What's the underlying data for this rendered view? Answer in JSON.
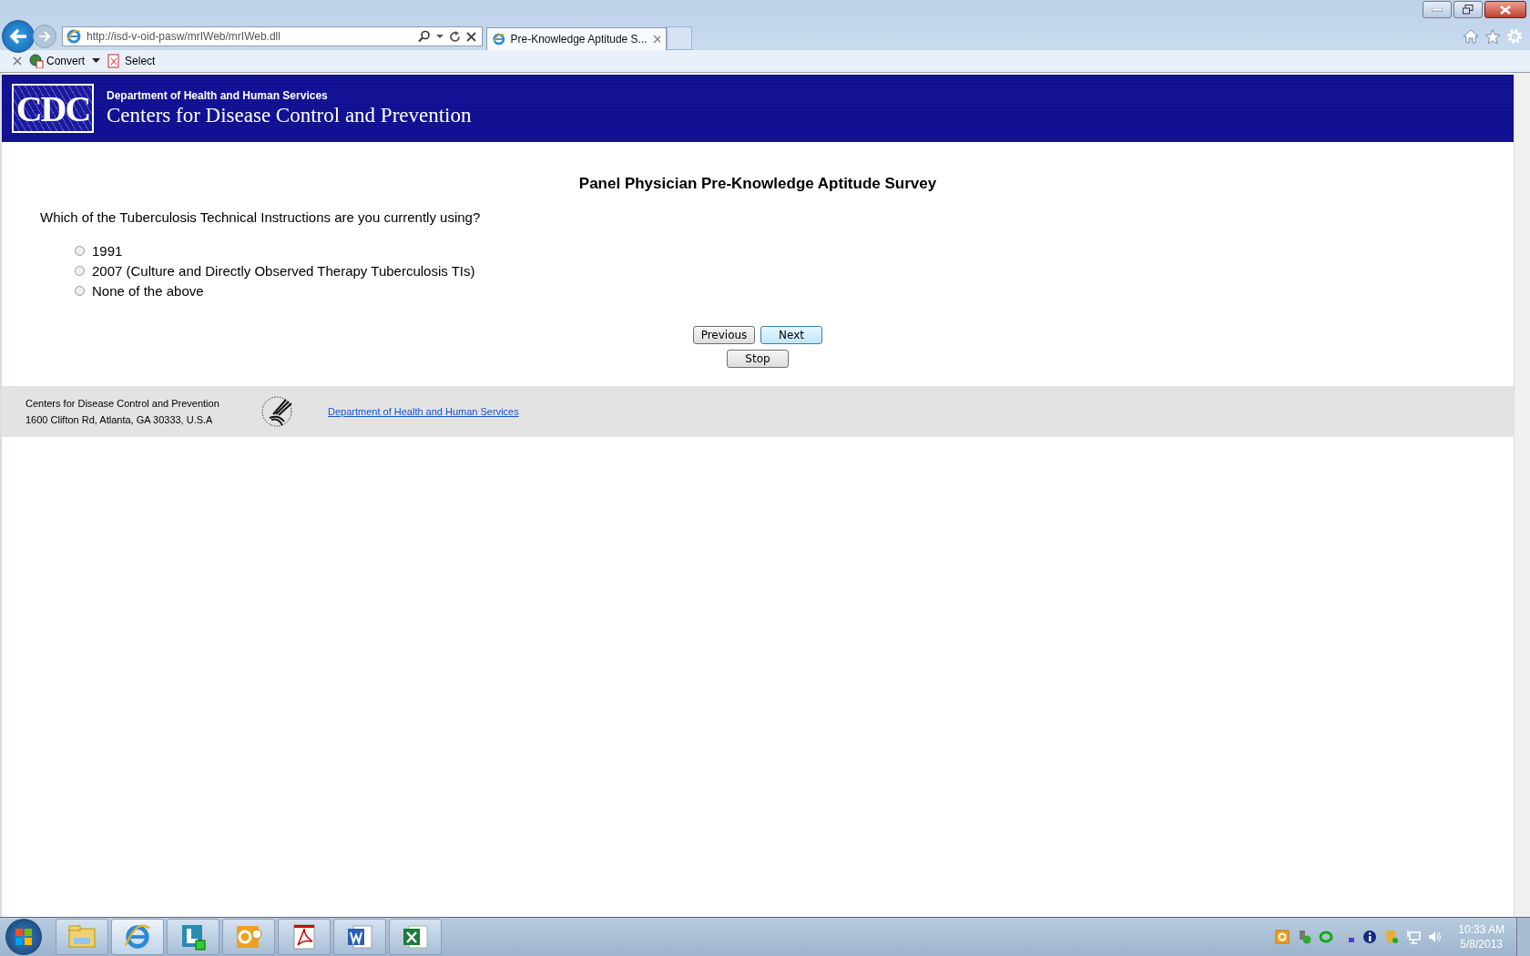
{
  "browser": {
    "url": "http://isd-v-oid-pasw/mrIWeb/mrIWeb.dll",
    "tab_title": "Pre-Knowledge Aptitude S...",
    "command_bar": [
      "Convert",
      "Select"
    ]
  },
  "header": {
    "logo": "CDC",
    "department": "Department of Health and Human Services",
    "title": "Centers for Disease Control and Prevention"
  },
  "survey": {
    "title": "Panel Physician Pre-Knowledge Aptitude Survey",
    "question": "Which of the Tuberculosis Technical Instructions are you currently using?",
    "options": [
      {
        "label": "1991",
        "selected": false
      },
      {
        "label": "2007 (Culture and Directly Observed Therapy Tuberculosis TIs)",
        "selected": false
      },
      {
        "label": "None of the above",
        "selected": false
      }
    ],
    "buttons": [
      {
        "label": "Previous",
        "kind": "nav",
        "default": false
      },
      {
        "label": "Next",
        "kind": "nav",
        "default": true
      },
      {
        "label": "Stop",
        "kind": "stop",
        "default": false
      }
    ]
  },
  "footer": {
    "organization": "Centers for Disease Control and Prevention",
    "address": "1600 Clifton Rd, Atlanta, GA 30333, U.S.A",
    "link": "Department of Health and Human Services"
  },
  "taskbar": {
    "time": "10:33 AM",
    "date": "5/8/2013"
  }
}
